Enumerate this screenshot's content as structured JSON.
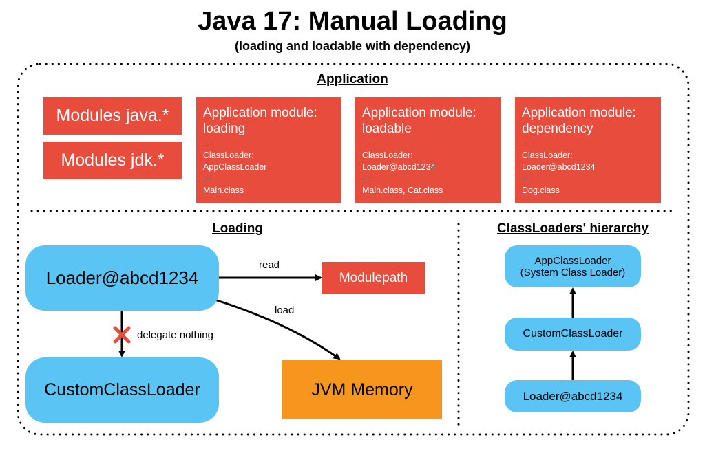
{
  "title": "Java 17: Manual Loading",
  "subtitle": "(loading and loadable with dependency)",
  "colors": {
    "module": "#e84c3d",
    "loader": "#5ac4f5",
    "memory": "#f7961d"
  },
  "application": {
    "heading": "Application",
    "modules": [
      "Modules java.*",
      "Modules jdk.*"
    ],
    "app_modules": [
      {
        "title": "Application module: loading",
        "sep1": "---",
        "cl_label": "ClassLoader:",
        "cl": "AppClassLoader",
        "sep2": "---",
        "classes": "Main.class"
      },
      {
        "title": "Application module: loadable",
        "sep1": "---",
        "cl_label": "ClassLoader:",
        "cl": "Loader@abcd1234",
        "sep2": "---",
        "classes": "Main.class, Cat.class"
      },
      {
        "title": "Application module: dependency",
        "sep1": "---",
        "cl_label": "ClassLoader:",
        "cl": "Loader@abcd1234",
        "sep2": "---",
        "classes": "Dog.class"
      }
    ]
  },
  "loading": {
    "heading": "Loading",
    "loader": "Loader@abcd1234",
    "modulepath": "Modulepath",
    "custom": "CustomClassLoader",
    "memory": "JVM Memory",
    "read_label": "read",
    "load_label": "load",
    "delegate_label": "delegate nothing"
  },
  "hierarchy": {
    "heading": "ClassLoaders' hierarchy",
    "app_line1": "AppClassLoader",
    "app_line2": "(System Class Loader)",
    "custom": "CustomClassLoader",
    "loader": "Loader@abcd1234"
  }
}
